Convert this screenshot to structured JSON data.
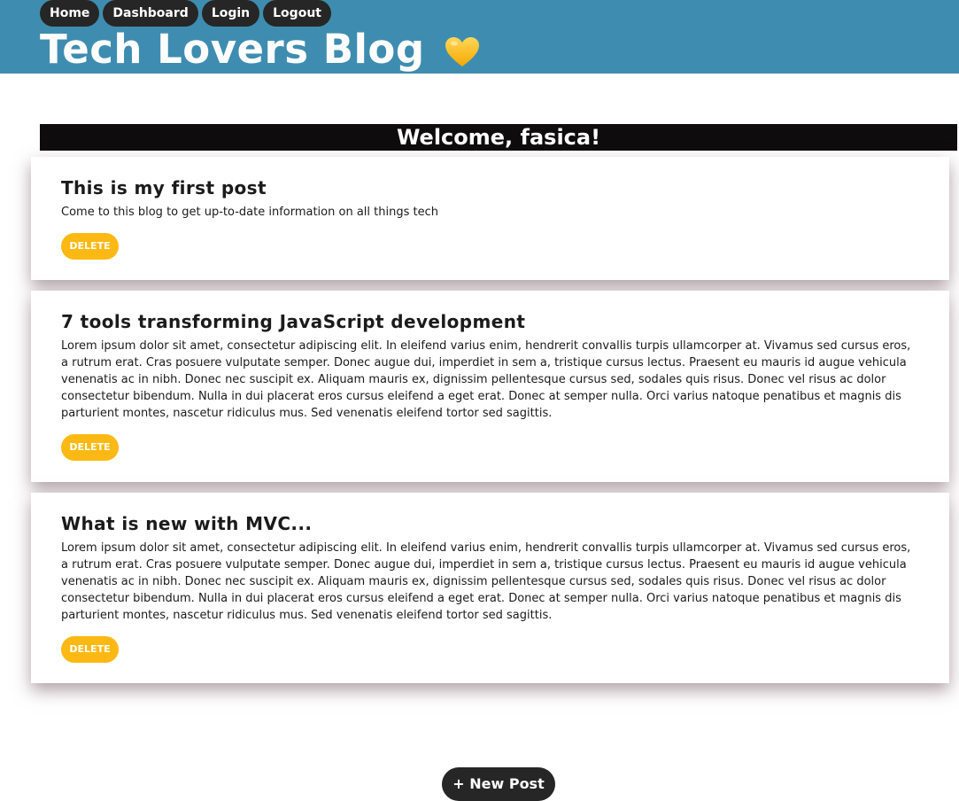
{
  "nav": {
    "items": [
      {
        "label": "Home"
      },
      {
        "label": "Dashboard"
      },
      {
        "label": "Login"
      },
      {
        "label": "Logout"
      }
    ]
  },
  "header": {
    "title": "Tech Lovers Blog",
    "icon": "yellow-heart-icon"
  },
  "welcome": {
    "text": "Welcome, fasica!"
  },
  "posts": [
    {
      "title": "This is my first post",
      "body": "Come to this blog to get up-to-date information on all things tech",
      "delete_label": "DELETE"
    },
    {
      "title": "7 tools transforming JavaScript development",
      "body": "Lorem ipsum dolor sit amet, consectetur adipiscing elit. In eleifend varius enim, hendrerit convallis turpis ullamcorper at. Vivamus sed cursus eros, a rutrum erat. Cras posuere vulputate semper. Donec augue dui, imperdiet in sem a, tristique cursus lectus. Praesent eu mauris id augue vehicula venenatis ac in nibh. Donec nec suscipit ex. Aliquam mauris ex, dignissim pellentesque cursus sed, sodales quis risus. Donec vel risus ac dolor consectetur bibendum. Nulla in dui placerat eros cursus eleifend a eget erat. Donec at semper nulla. Orci varius natoque penatibus et magnis dis parturient montes, nascetur ridiculus mus. Sed venenatis eleifend tortor sed sagittis.",
      "delete_label": "DELETE"
    },
    {
      "title": "What is new with MVC...",
      "body": "Lorem ipsum dolor sit amet, consectetur adipiscing elit. In eleifend varius enim, hendrerit convallis turpis ullamcorper at. Vivamus sed cursus eros, a rutrum erat. Cras posuere vulputate semper. Donec augue dui, imperdiet in sem a, tristique cursus lectus. Praesent eu mauris id augue vehicula venenatis ac in nibh. Donec nec suscipit ex. Aliquam mauris ex, dignissim pellentesque cursus sed, sodales quis risus. Donec vel risus ac dolor consectetur bibendum. Nulla in dui placerat eros cursus eleifend a eget erat. Donec at semper nulla. Orci varius natoque penatibus et magnis dis parturient montes, nascetur ridiculus mus. Sed venenatis eleifend tortor sed sagittis.",
      "delete_label": "DELETE"
    }
  ],
  "new_post": {
    "label": "+ New Post"
  },
  "colors": {
    "header_bg": "#3e8db0",
    "nav_button_bg": "#262626",
    "welcome_bar_bg": "#0e0c0c",
    "delete_button_bg": "#fdb913",
    "heart": "#fdc32f"
  }
}
